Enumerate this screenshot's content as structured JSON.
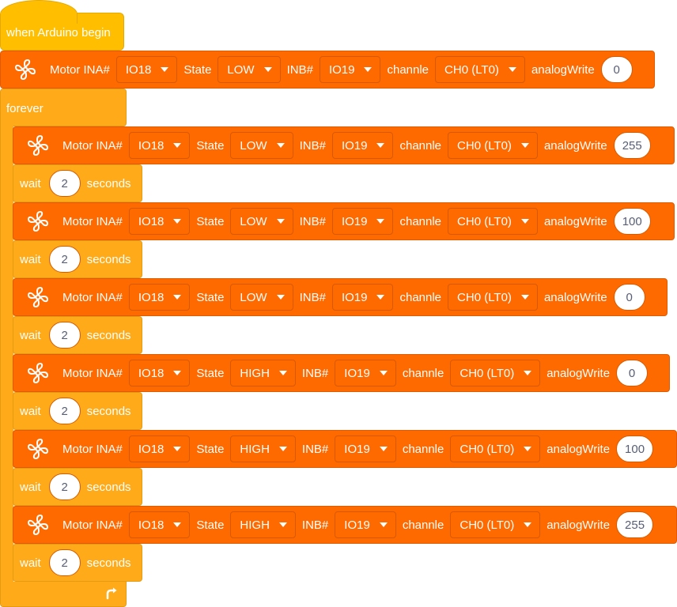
{
  "hat": {
    "label": "when Arduino begin"
  },
  "forever": {
    "label": "forever"
  },
  "motor_labels": {
    "motor_ina": "Motor INA#",
    "state": "State",
    "inb": "INB#",
    "channel": "channle",
    "analog": "analogWrite"
  },
  "wait_labels": {
    "wait": "wait",
    "seconds": "seconds"
  },
  "setup_block": {
    "ina": "IO18",
    "state": "LOW",
    "inb": "IO19",
    "channel": "CH0 (LT0)",
    "value": "0"
  },
  "loop_blocks": [
    {
      "ina": "IO18",
      "state": "LOW",
      "inb": "IO19",
      "channel": "CH0 (LT0)",
      "value": "255"
    },
    {
      "ina": "IO18",
      "state": "LOW",
      "inb": "IO19",
      "channel": "CH0 (LT0)",
      "value": "100"
    },
    {
      "ina": "IO18",
      "state": "LOW",
      "inb": "IO19",
      "channel": "CH0 (LT0)",
      "value": "0"
    },
    {
      "ina": "IO18",
      "state": "HIGH",
      "inb": "IO19",
      "channel": "CH0 (LT0)",
      "value": "0"
    },
    {
      "ina": "IO18",
      "state": "HIGH",
      "inb": "IO19",
      "channel": "CH0 (LT0)",
      "value": "100"
    },
    {
      "ina": "IO18",
      "state": "HIGH",
      "inb": "IO19",
      "channel": "CH0 (LT0)",
      "value": "255"
    }
  ],
  "waits": [
    "2",
    "2",
    "2",
    "2",
    "2",
    "2"
  ],
  "colors": {
    "event": "#ffbf00",
    "control": "#ffab19",
    "motor": "#ff6a00"
  },
  "icons": {
    "motor": "fan-icon",
    "loop": "loop-arrow-icon"
  }
}
